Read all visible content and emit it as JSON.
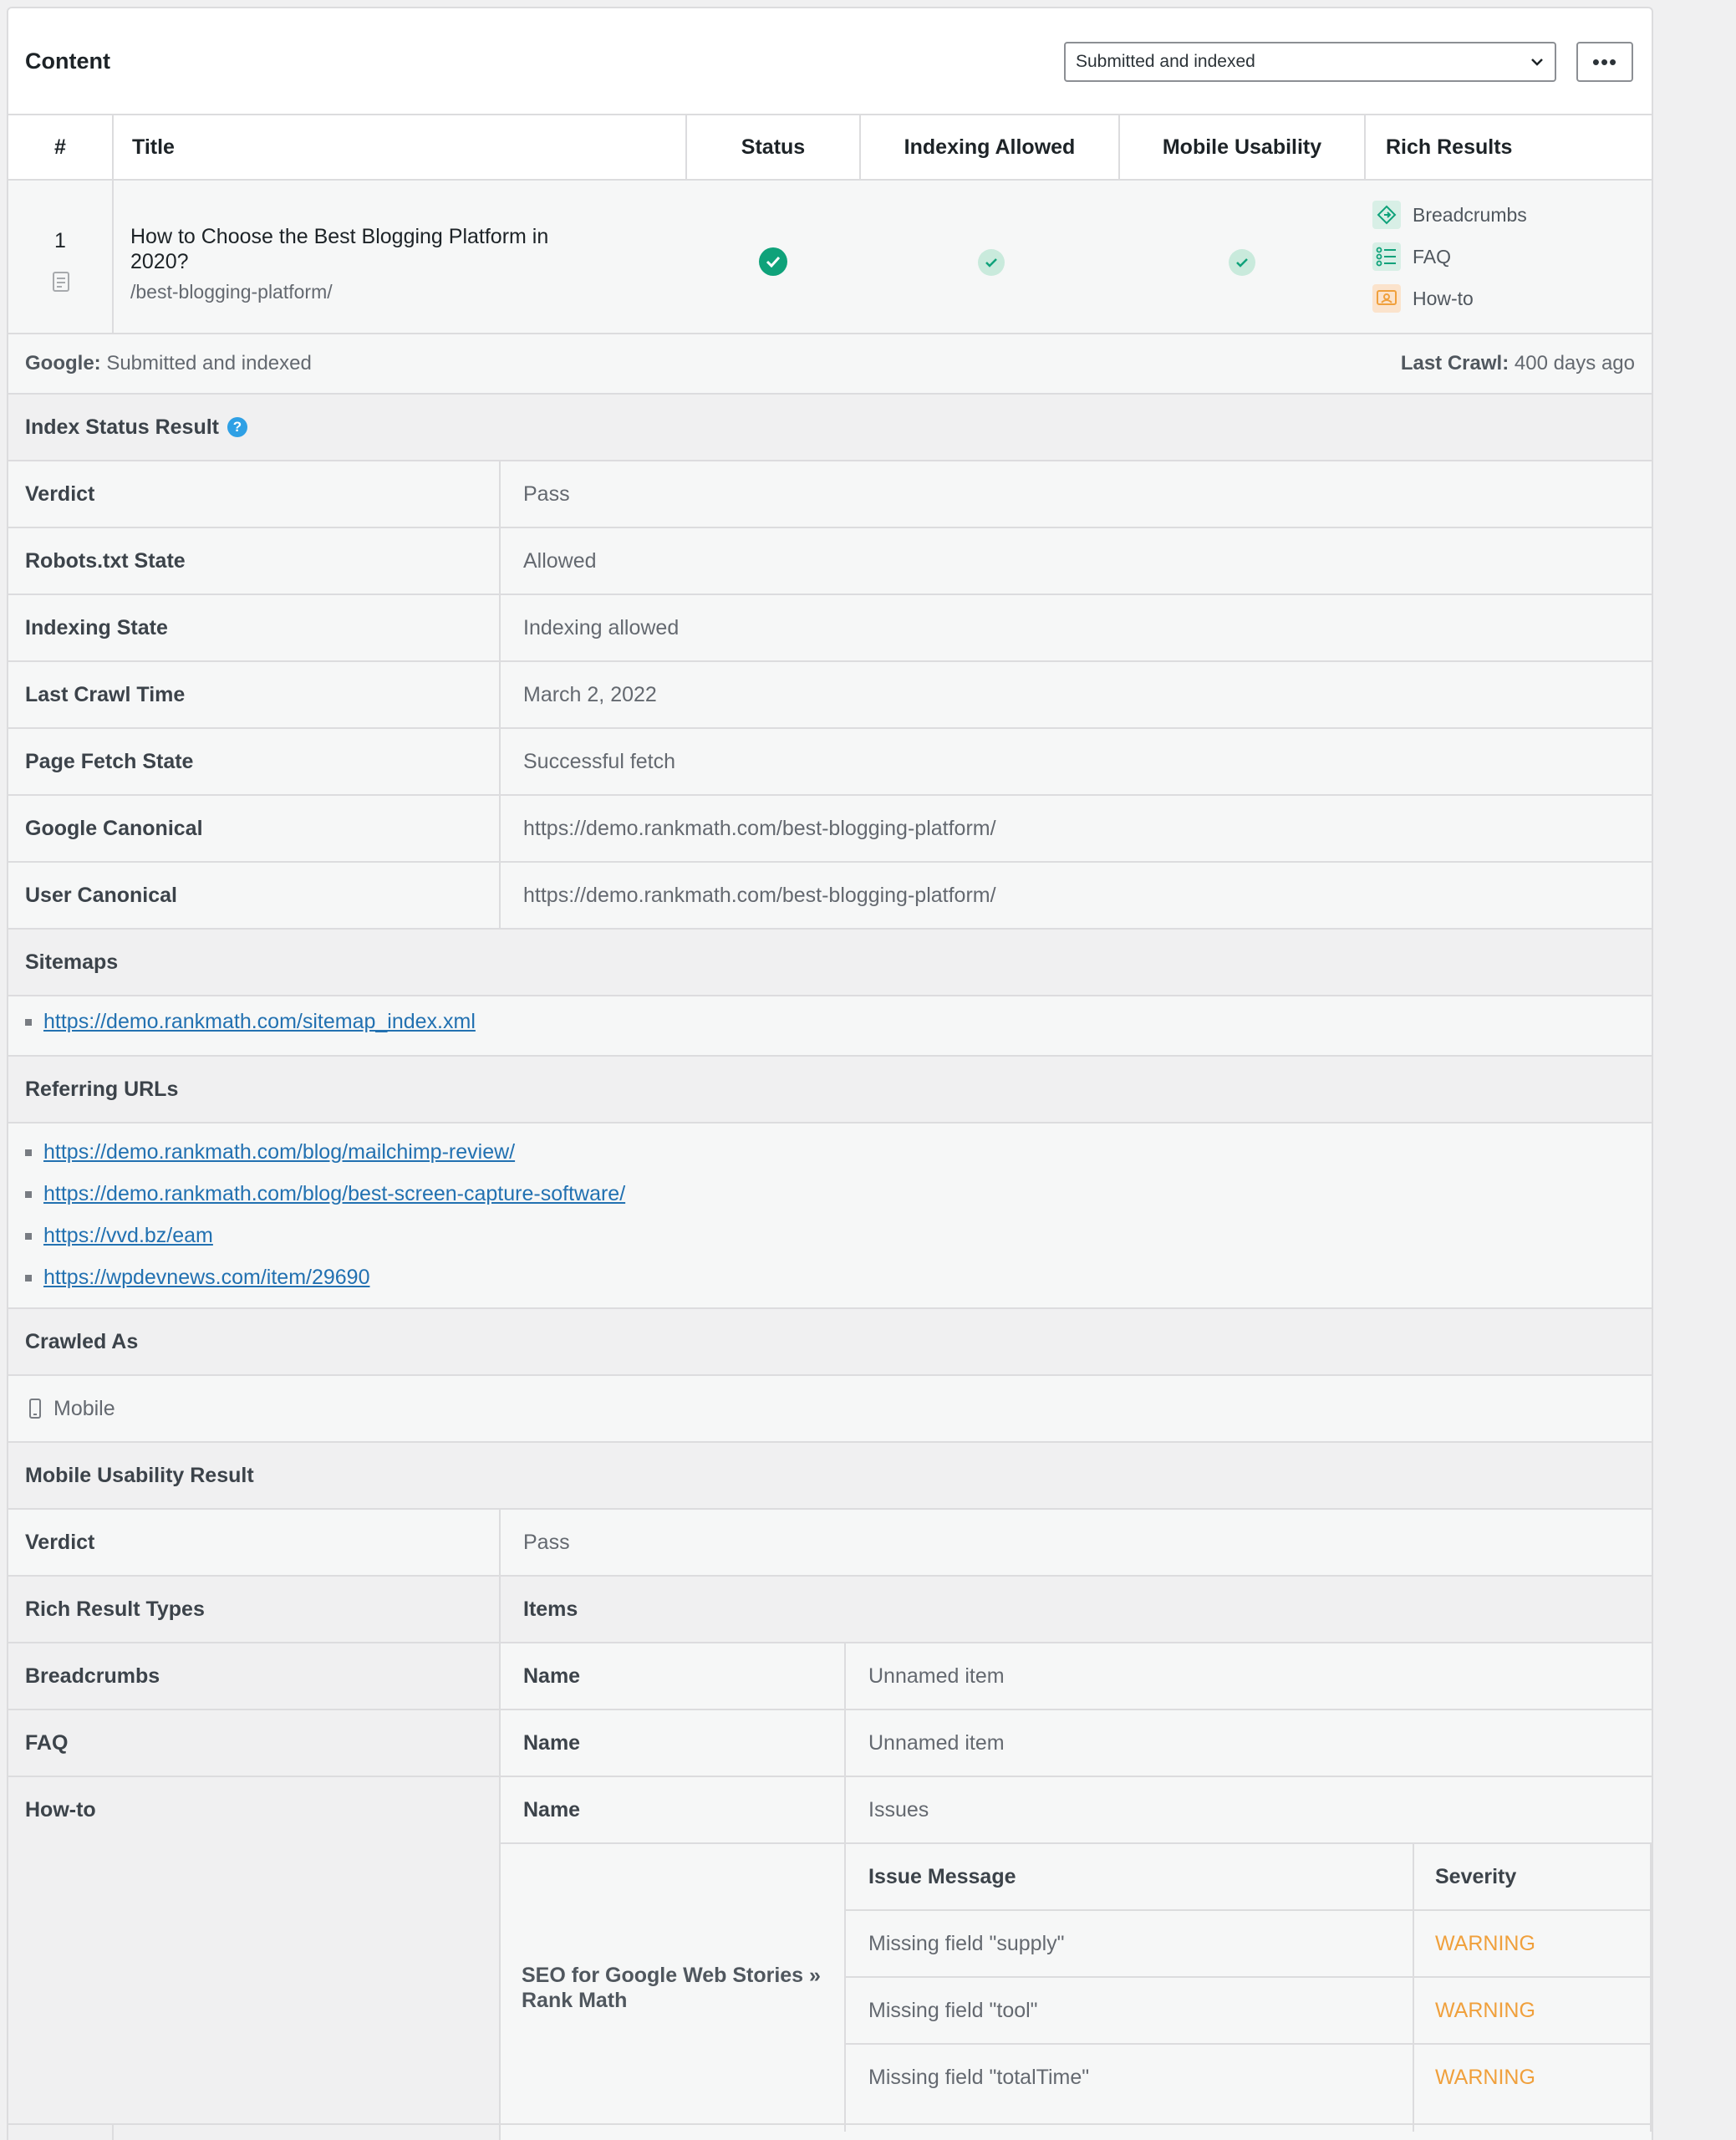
{
  "header": {
    "title": "Content",
    "filter_value": "Submitted and indexed",
    "more_label": "•••"
  },
  "columns": [
    "#",
    "Title",
    "Status",
    "Indexing Allowed",
    "Mobile Usability",
    "Rich Results"
  ],
  "row": {
    "number": "1",
    "title": "How to Choose the Best Blogging Platform in 2020?",
    "slug": "/best-blogging-platform/",
    "rich_results": [
      "Breadcrumbs",
      "FAQ",
      "How-to"
    ]
  },
  "google_line": {
    "google_label": "Google:",
    "google_value": "Submitted and indexed",
    "crawl_label": "Last Crawl:",
    "crawl_value": "400 days ago"
  },
  "index_status": {
    "title": "Index Status Result",
    "rows": [
      {
        "k": "Verdict",
        "v": "Pass"
      },
      {
        "k": "Robots.txt State",
        "v": "Allowed"
      },
      {
        "k": "Indexing State",
        "v": "Indexing allowed"
      },
      {
        "k": "Last Crawl Time",
        "v": "March 2, 2022"
      },
      {
        "k": "Page Fetch State",
        "v": "Successful fetch"
      },
      {
        "k": "Google Canonical",
        "v": "https://demo.rankmath.com/best-blogging-platform/"
      },
      {
        "k": "User Canonical",
        "v": "https://demo.rankmath.com/best-blogging-platform/"
      }
    ]
  },
  "sitemaps": {
    "title": "Sitemaps",
    "links": [
      "https://demo.rankmath.com/sitemap_index.xml"
    ]
  },
  "referring": {
    "title": "Referring URLs",
    "links": [
      "https://demo.rankmath.com/blog/mailchimp-review/",
      "https://demo.rankmath.com/blog/best-screen-capture-software/",
      "https://vvd.bz/eam",
      "https://wpdevnews.com/item/29690"
    ]
  },
  "crawled_as": {
    "title": "Crawled As",
    "value": "Mobile"
  },
  "mobile_usability": {
    "title": "Mobile Usability Result",
    "verdict_label": "Verdict",
    "verdict_value": "Pass"
  },
  "rich_types": {
    "col1": "Rich Result Types",
    "col2": "Items",
    "rows": [
      {
        "type": "Breadcrumbs",
        "name_label": "Name",
        "value": "Unnamed item"
      },
      {
        "type": "FAQ",
        "name_label": "Name",
        "value": "Unnamed item"
      },
      {
        "type": "How-to",
        "name_label": "Name",
        "value": "Issues"
      }
    ],
    "howto_item": "SEO for Google Web Stories » Rank Math",
    "issue_header": "Issue Message",
    "severity_header": "Severity",
    "issues": [
      {
        "msg": "Missing field \"supply\"",
        "sev": "WARNING"
      },
      {
        "msg": "Missing field \"tool\"",
        "sev": "WARNING"
      },
      {
        "msg": "Missing field \"totalTime\"",
        "sev": "WARNING"
      }
    ]
  },
  "colors": {
    "link": "#2271b1",
    "success": "#0fa27a",
    "warning": "#f0a03c"
  }
}
